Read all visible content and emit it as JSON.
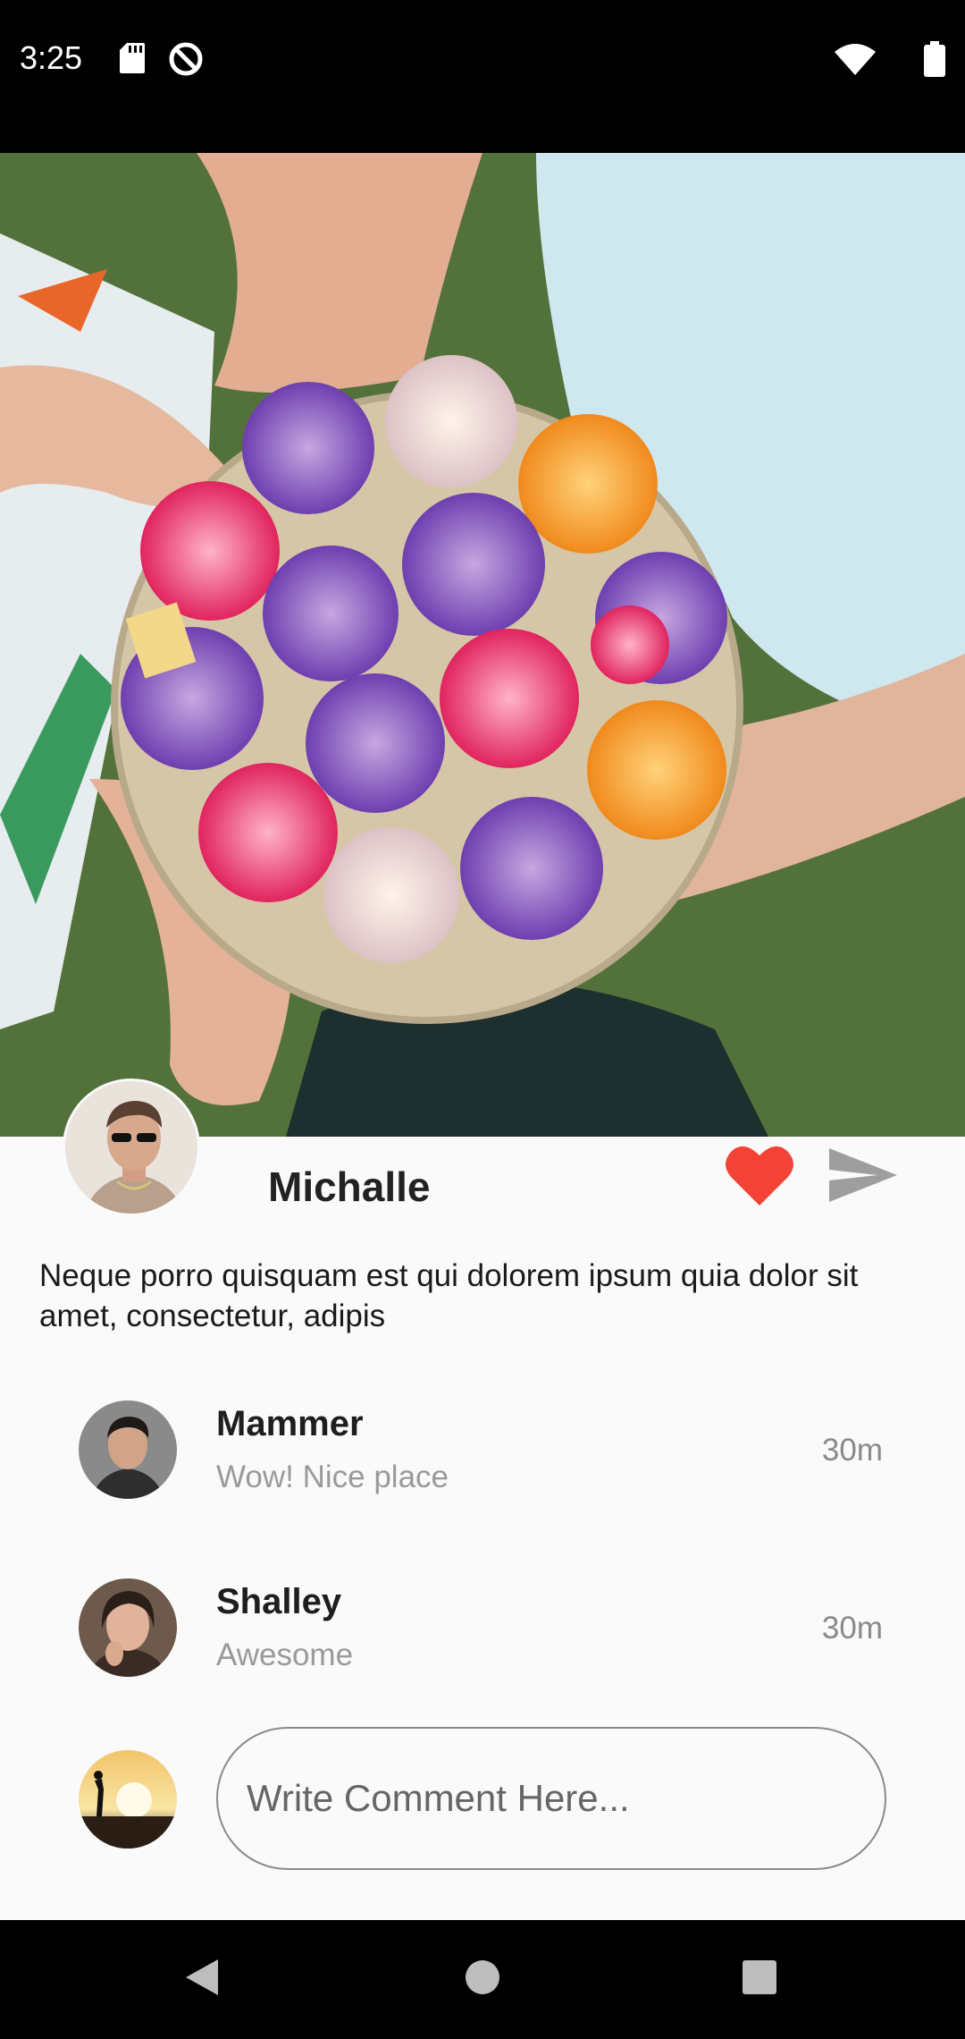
{
  "status_bar": {
    "time": "3:25",
    "icons": [
      "sd-card-icon",
      "do-not-disturb-icon",
      "wifi-icon",
      "battery-icon"
    ]
  },
  "post": {
    "image": "cupcakes-platter-photo",
    "author": "Michalle",
    "liked": true,
    "caption": "Neque porro quisquam est qui dolorem ipsum quia dolor sit amet, consectetur, adipis"
  },
  "comments": [
    {
      "user": "Mammer",
      "text": "Wow! Nice place",
      "time": "30m"
    },
    {
      "user": "Shalley",
      "text": "Awesome",
      "time": "30m"
    }
  ],
  "composer": {
    "placeholder": "Write Comment Here..."
  },
  "colors": {
    "like": "#f44336",
    "send": "#9e9e9e",
    "background": "#fafafa"
  },
  "nav": [
    "back-icon",
    "home-icon",
    "recents-icon"
  ]
}
